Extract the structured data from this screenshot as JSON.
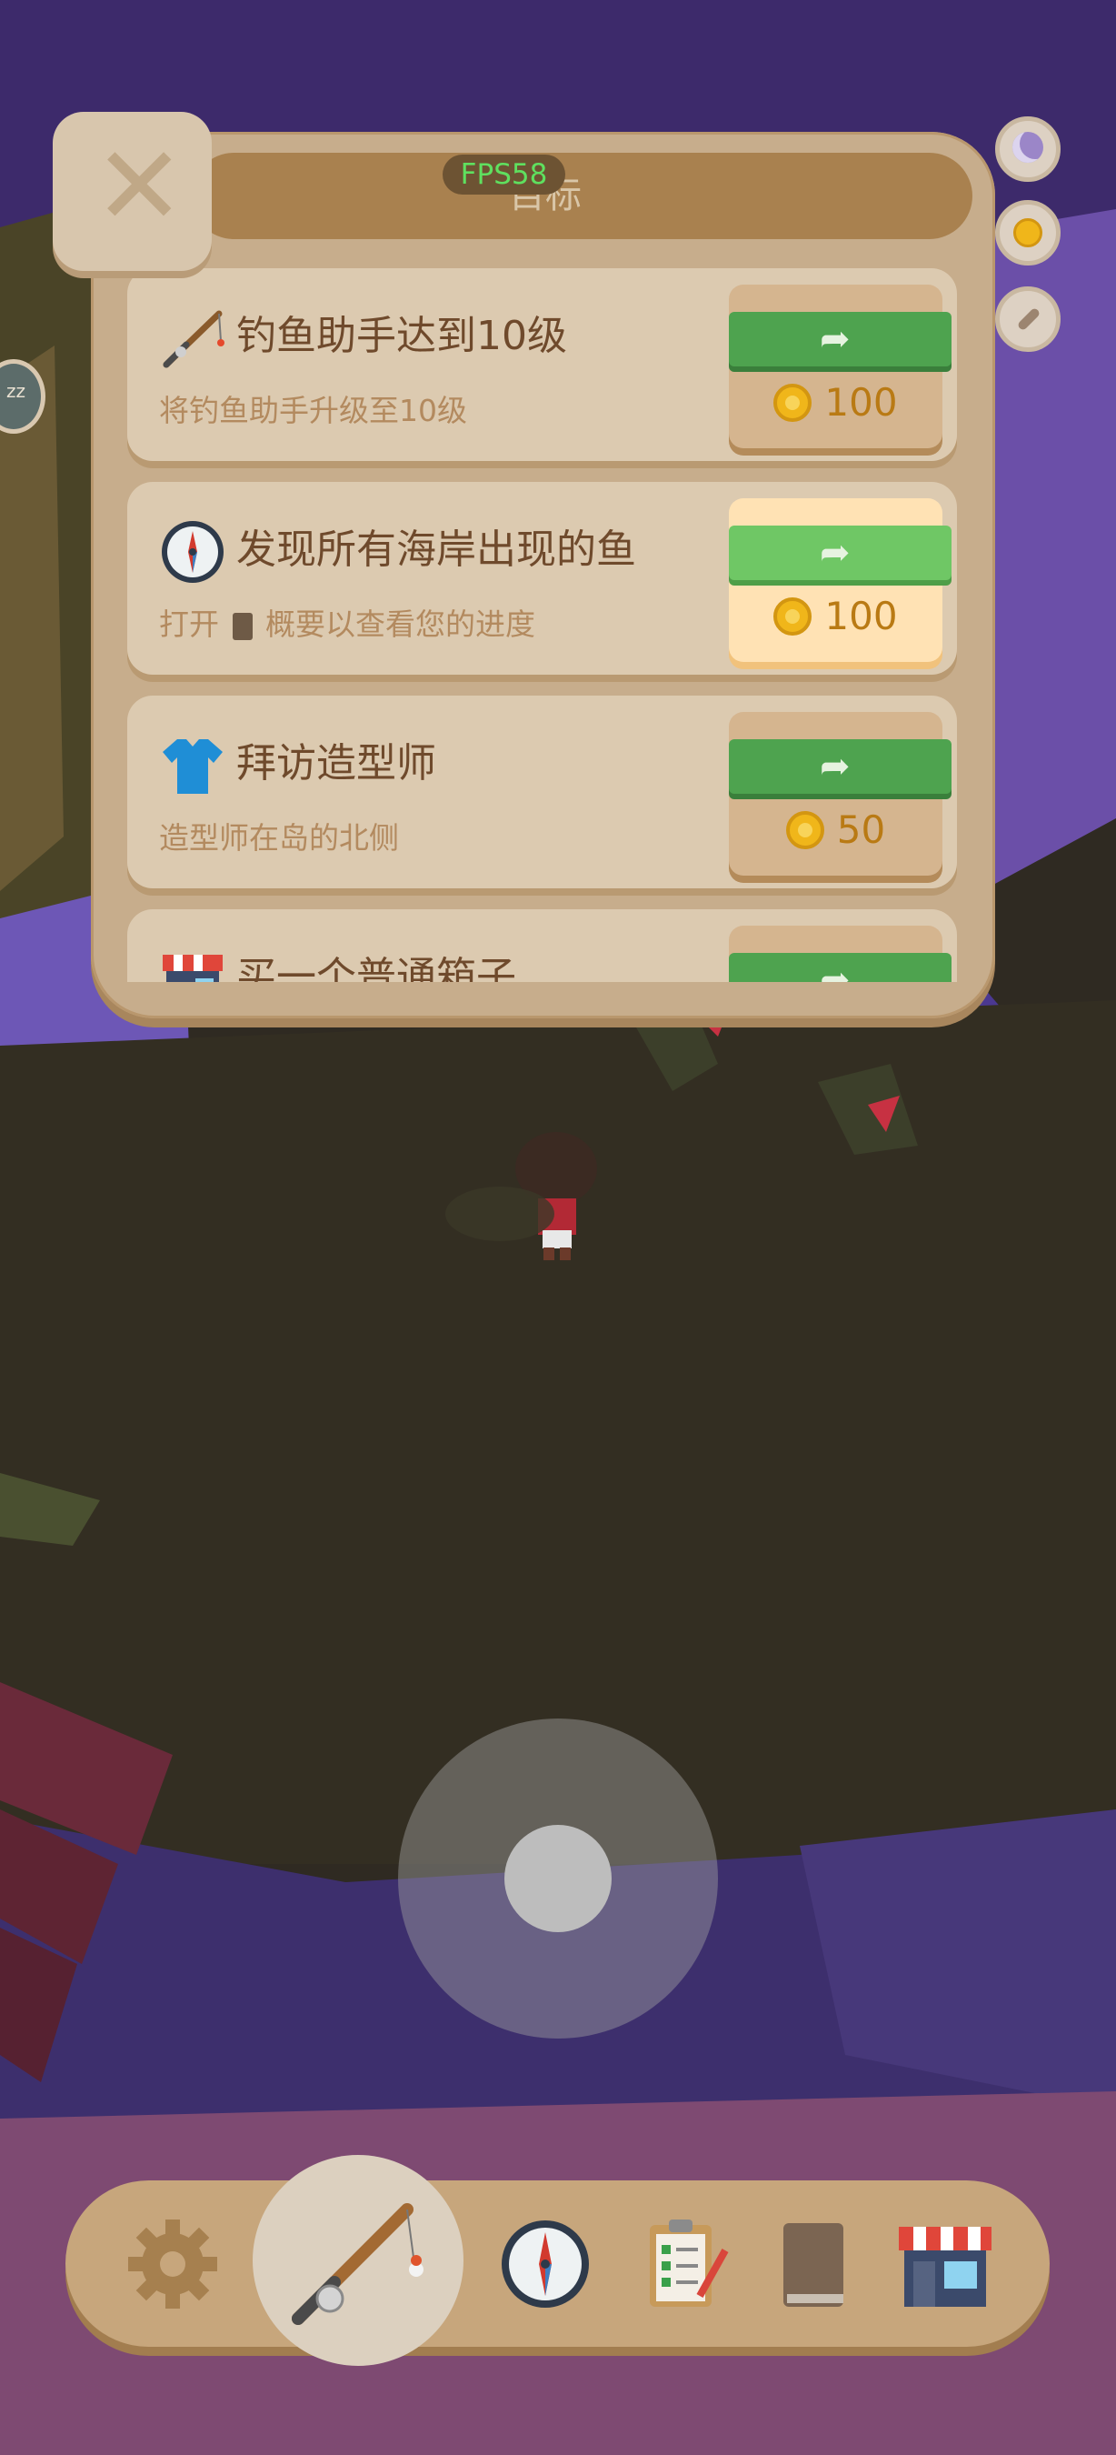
{
  "hud": {
    "fps": "FPS58",
    "side_left": "zz"
  },
  "panel": {
    "title": "目标",
    "close_label": "✕",
    "tasks": [
      {
        "icon": "fishing-rod-icon",
        "title": "钓鱼助手达到10级",
        "desc": "将钓鱼助手升级至10级",
        "reward": "100",
        "action": "➦"
      },
      {
        "icon": "compass-icon",
        "title": "发现所有海岸出现的鱼",
        "desc_prefix": "打开",
        "desc_suffix": "概要以查看您的进度",
        "reward": "100",
        "action": "➦",
        "highlighted": true
      },
      {
        "icon": "tshirt-icon",
        "title": "拜访造型师",
        "desc": "造型师在岛的北侧",
        "reward": "50",
        "action": "➦"
      },
      {
        "icon": "shop-icon",
        "title": "买一个普通箱子",
        "action": "➦"
      }
    ]
  },
  "nav": {
    "items": [
      {
        "icon": "gear-icon"
      },
      {
        "icon": "fishing-rod-icon"
      },
      {
        "icon": "compass-icon"
      },
      {
        "icon": "clipboard-icon"
      },
      {
        "icon": "book-icon"
      },
      {
        "icon": "shop-icon"
      }
    ]
  },
  "colors": {
    "panel": "#c7ad8c",
    "go_button": "#4ea34f",
    "coin": "#f0b61a",
    "text_brown": "#6f4a2c"
  }
}
